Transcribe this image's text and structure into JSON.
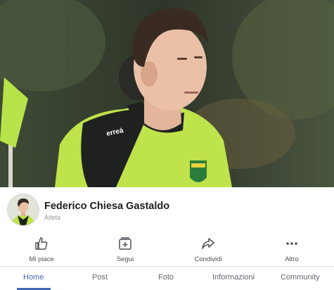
{
  "colors": {
    "accent": "#4267b2",
    "jersey": "#bfe34a",
    "jersey_black": "#1f2220",
    "text_primary": "#1c1e21",
    "text_secondary": "#90949c"
  },
  "profile": {
    "name": "Federico Chiesa Gastaldo",
    "category": "Atleta",
    "jersey_brand": "erreà"
  },
  "actions": [
    {
      "label": "Mi piace",
      "icon": "thumbs-up-icon"
    },
    {
      "label": "Segui",
      "icon": "follow-icon"
    },
    {
      "label": "Condividi",
      "icon": "share-icon"
    },
    {
      "label": "Altro",
      "icon": "more-icon"
    }
  ],
  "tabs": [
    {
      "label": "Home",
      "active": true
    },
    {
      "label": "Post",
      "active": false
    },
    {
      "label": "Foto",
      "active": false
    },
    {
      "label": "Informazioni",
      "active": false
    },
    {
      "label": "Community",
      "active": false
    }
  ]
}
